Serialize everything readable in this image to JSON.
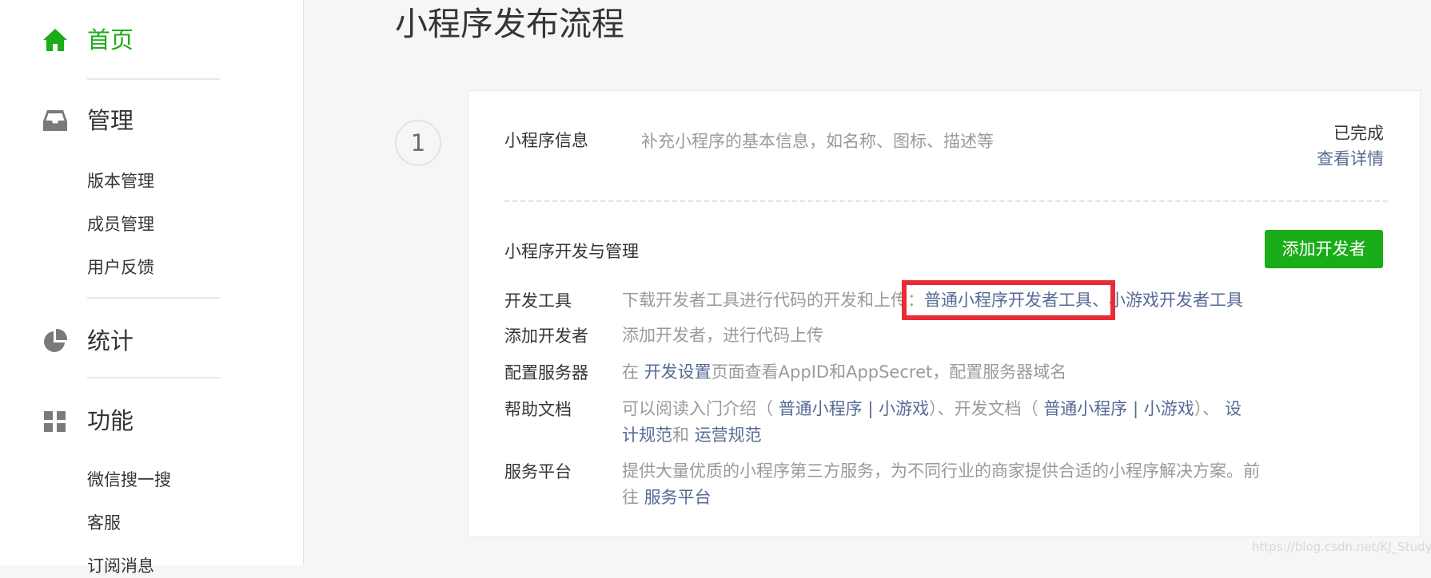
{
  "sidebar": {
    "home": {
      "label": "首页",
      "icon": "home-icon"
    },
    "manage": {
      "label": "管理",
      "icon": "inbox-icon",
      "items": [
        "版本管理",
        "成员管理",
        "用户反馈"
      ]
    },
    "stats": {
      "label": "统计",
      "icon": "pie-chart-icon"
    },
    "features": {
      "label": "功能",
      "icon": "grid-icon",
      "items": [
        "微信搜一搜",
        "客服",
        "订阅消息"
      ]
    }
  },
  "main": {
    "title": "小程序发布流程",
    "step_number": "1",
    "info": {
      "label": "小程序信息",
      "desc": "补充小程序的基本信息，如名称、图标、描述等",
      "status": "已完成",
      "detail_link": "查看详情"
    },
    "dev": {
      "section_title": "小程序开发与管理",
      "add_dev_button": "添加开发者",
      "rows": [
        {
          "label": "开发工具",
          "text1": "下载开发者工具进行代码的开发和上传：",
          "link1": "普通小程序开发者工具",
          "sep": "、",
          "link2": "小游戏开发者工具"
        },
        {
          "label": "添加开发者",
          "text1": "添加开发者，进行代码上传"
        },
        {
          "label": "配置服务器",
          "pre": "在 ",
          "link1": "开发设置",
          "text1": "页面查看AppID和AppSecret，配置服务器域名"
        },
        {
          "label": "帮助文档",
          "text1": "可以阅读入门介绍（ ",
          "link1": "普通小程序 | 小游戏",
          "text2": "）、开发文档（ ",
          "link2": "普通小程序 | 小游戏",
          "text3": "）、 ",
          "link3a": "设",
          "link3b": "计规范",
          "text4": "和 ",
          "link4": "运营规范"
        },
        {
          "label": "服务平台",
          "text1": "提供大量优质的小程序第三方服务，为不同行业的商家提供合适的小程序解决方案。前",
          "text2": "往 ",
          "link1": "服务平台"
        }
      ]
    }
  },
  "watermark": "https://blog.csdn.net/KJ_Study",
  "colors": {
    "accent": "#1aad19",
    "link": "#576b95",
    "highlight": "#ea2b36"
  }
}
